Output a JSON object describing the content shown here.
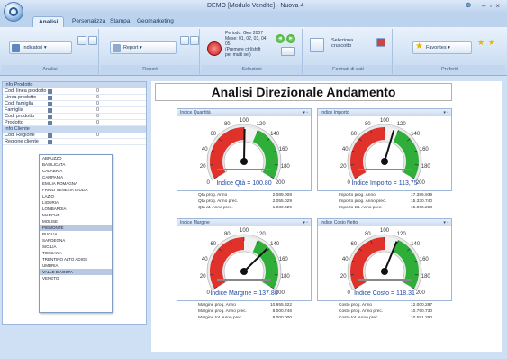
{
  "window": {
    "title": "DEMO [Modulo Vendite] - Nuova 4"
  },
  "tabs": [
    "Analisi",
    "Personalizza",
    "Stampa",
    "Geomarketing"
  ],
  "ribbon": {
    "groups": [
      "Analisi",
      "Report",
      "Selezioni",
      "Formati di dati",
      "Preferiti"
    ],
    "indicatori_label": "Indicatori",
    "report_label": "Report",
    "selection_info": "Periodo: Gen 2007\nMese: 01, 02, 03, 04, 05\n(Premere ctrl/shift\n per multi sel)",
    "cruscotto_label": "Seleziona\ncruscotto",
    "favorites_label": "Favorites",
    "accent": "#2b5a94"
  },
  "left_panel": {
    "sections": [
      {
        "title": "Info Prodotto",
        "rows": [
          "Cod. linea prodotto",
          "Linea prodotto",
          "Cod. famiglia",
          "Famiglia",
          "Cod. prodotto",
          "Prodotto"
        ]
      },
      {
        "title": "Info Cliente",
        "rows": [
          "Cod. Regione",
          "Regione cliente"
        ]
      }
    ],
    "dropdown_items": [
      "ABRUZZO",
      "BASILICATA",
      "CALABRIA",
      "CAMPANIA",
      "EMILIA ROMAGNA",
      "FRIULI VENEZIA GIULIA",
      "LAZIO",
      "LIGURIA",
      "LOMBARDIA",
      "MARCHE",
      "MOLISE",
      "PIEMONTE",
      "PUGLIA",
      "SARDEGNA",
      "SICILIA",
      "TOSCANA",
      "TRENTINO ALTO ADIGE",
      "UMBRIA",
      "VALLE D'AOSTA",
      "VENETO"
    ],
    "highlighted_dropdown_indices": [
      11,
      18
    ]
  },
  "dashboard": {
    "title": "Analisi Direzionale Andamento",
    "gauges": [
      {
        "header": "Indice Quantità",
        "label": "Indice Qtà = 100.80",
        "value": 100.8,
        "stats": [
          [
            "Qtà prog. Anno",
            "2.089.008"
          ],
          [
            "Qtà prog. Anno prec.",
            "2.055.029"
          ],
          [
            "Qtà at. Anno prec.",
            "1.989.029"
          ]
        ]
      },
      {
        "header": "Indice Importo",
        "label": "Indice Importo = 113,75",
        "value": 113.75,
        "stats": [
          [
            "Importo prog. Anno",
            "17.386.939"
          ],
          [
            "Importo prog. Anno prec.",
            "15.330.740"
          ],
          [
            "Importo tot. Anno prec.",
            "15.866.298"
          ]
        ]
      },
      {
        "header": "Indice Margine",
        "label": "Indice Margine = 137.80",
        "value": 137.8,
        "stats": [
          [
            "Margine prog. Anno",
            "10.955.322"
          ],
          [
            "Margine prog. Anno prec.",
            "8.000.746"
          ],
          [
            "Margine tot. Anno prec.",
            "8.000.000"
          ]
        ]
      },
      {
        "header": "Indice Costo Netto",
        "label": "Indice Costo = 118.31",
        "value": 118.31,
        "stats": [
          [
            "Costo prog. Anno",
            "12.000.287"
          ],
          [
            "Costo prog. Anno prec.",
            "10.790.730"
          ],
          [
            "Costo tot. Anno prec.",
            "10.581.290"
          ]
        ]
      }
    ],
    "scale_ticks": [
      0,
      20,
      40,
      60,
      80,
      100,
      120,
      140,
      160,
      180,
      200
    ]
  }
}
